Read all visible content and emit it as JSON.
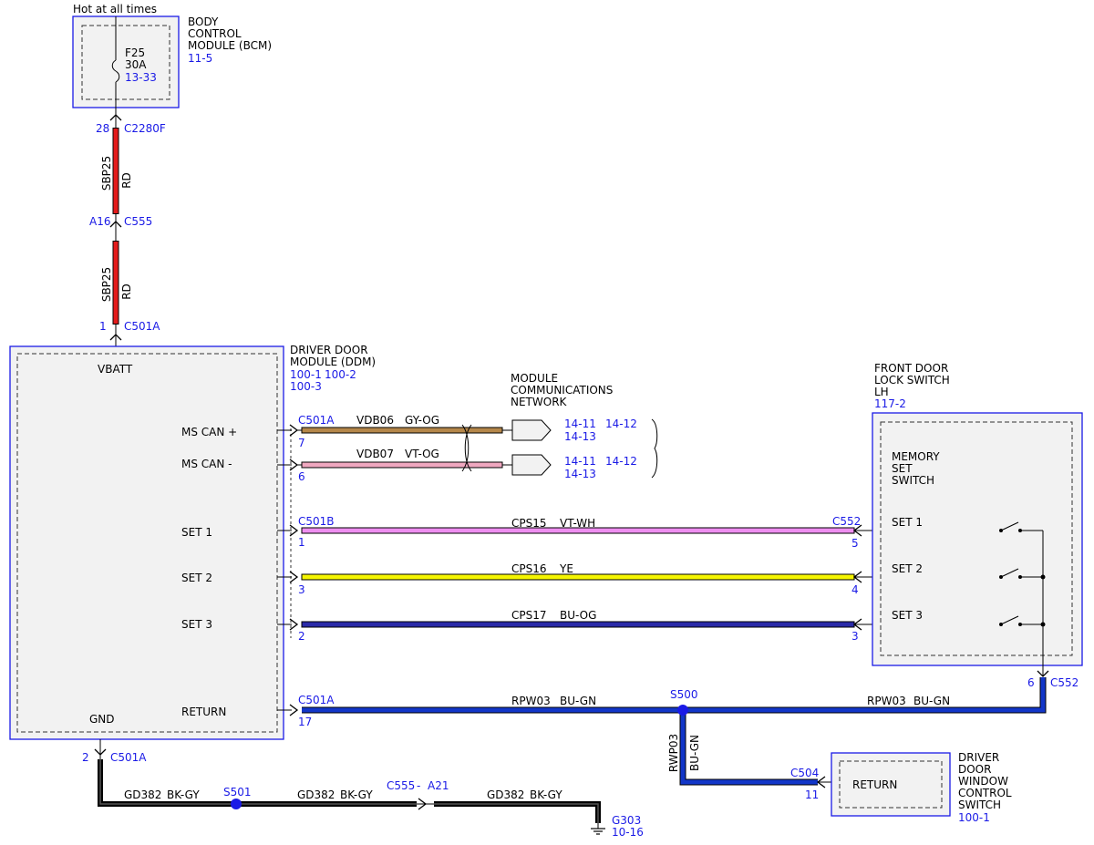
{
  "colors": {
    "ref_blue": "#1a1ae6",
    "wire_red": "#e41b1b",
    "wire_gy_og": "#b5874a",
    "wire_vt_og": "#f0a8c0",
    "wire_vt_wh": "#ee8ef0",
    "wire_ye": "#f5f500",
    "wire_bu_og": "#2a2aa8",
    "wire_bu_gn": "#1236c8",
    "wire_bk_gy": "#1a1a1a",
    "module_fill": "#f2f2f2"
  },
  "power_label": "Hot at all times",
  "bcm": {
    "name_lines": [
      "BODY",
      "CONTROL",
      "MODULE (BCM)"
    ],
    "ref": "11-5"
  },
  "fuse": {
    "id": "F25",
    "rating": "30A",
    "ref": "13-33"
  },
  "conn_c2280f": {
    "pin": "28",
    "name": "C2280F"
  },
  "wire_sbp25_upper": {
    "circuit": "SBP25",
    "color": "RD"
  },
  "conn_c555": {
    "pin": "A16",
    "name": "C555"
  },
  "wire_sbp25_lower": {
    "circuit": "SBP25",
    "color": "RD"
  },
  "conn_c501a_top": {
    "pin": "1",
    "name": "C501A"
  },
  "ddm": {
    "name_lines": [
      "DRIVER DOOR",
      "MODULE (DDM)"
    ],
    "refs": [
      "100-1",
      "100-2",
      "100-3"
    ],
    "vbatt": "VBATT",
    "gnd": "GND",
    "pins": {
      "ms_can_plus": "MS CAN +",
      "ms_can_minus": "MS CAN -",
      "set1": "SET 1",
      "set2": "SET 2",
      "set3": "SET 3",
      "return": "RETURN"
    }
  },
  "network": {
    "name_lines": [
      "MODULE",
      "COMMUNICATIONS",
      "NETWORK"
    ]
  },
  "can_plus": {
    "conn": "C501A",
    "pin": "7",
    "circuit": "VDB06",
    "color": "GY-OG",
    "refs": [
      "14-11",
      "14-12",
      "14-13"
    ]
  },
  "can_minus": {
    "pin": "6",
    "circuit": "VDB07",
    "color": "VT-OG",
    "refs": [
      "14-11",
      "14-12",
      "14-13"
    ]
  },
  "set1_wire": {
    "conn": "C501B",
    "pin_ddm": "1",
    "circuit": "CPS15",
    "color": "VT-WH",
    "conn_switch": "C552",
    "pin_switch": "5"
  },
  "set2_wire": {
    "pin_ddm": "3",
    "circuit": "CPS16",
    "color": "YE",
    "pin_switch": "4"
  },
  "set3_wire": {
    "pin_ddm": "2",
    "circuit": "CPS17",
    "color": "BU-OG",
    "pin_switch": "3"
  },
  "lock_switch": {
    "name_lines": [
      "FRONT DOOR",
      "LOCK SWITCH",
      "LH"
    ],
    "ref": "117-2",
    "inner_lines": [
      "MEMORY",
      "SET",
      "SWITCH"
    ],
    "set1": "SET 1",
    "set2": "SET 2",
    "set3": "SET 3",
    "pin_return": "6",
    "conn_return": "C552"
  },
  "return_wire": {
    "conn": "C501A",
    "pin": "17",
    "circuit": "RPW03",
    "color": "BU-GN",
    "splice": "S500",
    "circuit_right": "RPW03",
    "color_right": "BU-GN"
  },
  "return_branch": {
    "circuit": "RWP03",
    "color": "BU-GN",
    "conn": "C504",
    "pin": "11"
  },
  "window_switch": {
    "pin_label": "RETURN",
    "name_lines": [
      "DRIVER",
      "DOOR",
      "WINDOW",
      "CONTROL",
      "SWITCH"
    ],
    "ref": "100-1"
  },
  "ground": {
    "pin": "2",
    "conn": "C501A",
    "seg1_circuit": "GD382",
    "seg1_color": "BK-GY",
    "splice": "S501",
    "seg2_circuit": "GD382",
    "seg2_color": "BK-GY",
    "inline_conn": "C555",
    "inline_sep": "-",
    "inline_pin": "A21",
    "seg3_circuit": "GD382",
    "seg3_color": "BK-GY",
    "ground_id": "G303",
    "ground_ref": "10-16"
  }
}
